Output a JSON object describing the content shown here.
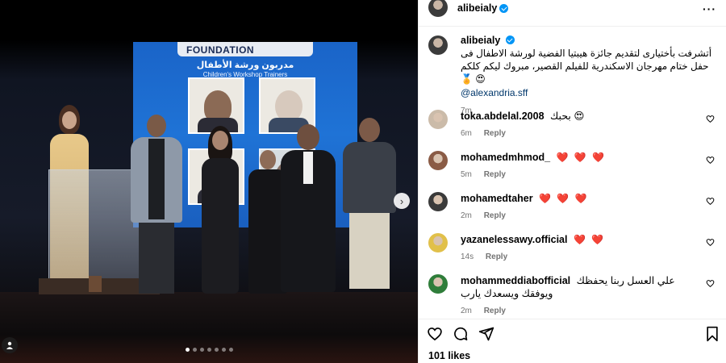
{
  "post": {
    "username": "alibeialy",
    "more_icon": "more-dots-icon",
    "caption": "أتشرفت بأختيارى لتقديم جائزة هيبتيا الفضية لورشة الاطفال فى حفل ختام مهرجان الاسكندرية للفيلم القصير، مبروك ليكم كلكم 😍 🏅",
    "caption_mention": "@alexandria.sff",
    "caption_time": "7m",
    "likes": "101 likes"
  },
  "media": {
    "screen_banner": "FOUNDATION",
    "screen_title_ar": "مدربون ورشة الأطفال",
    "screen_title_en": "Children's Workshop Trainers",
    "carousel_count": 7,
    "carousel_active": 0,
    "next_icon": "chevron-right-icon",
    "tag_icon": "user-tag-icon"
  },
  "comments": [
    {
      "user": "toka.abdelal.2008",
      "text": "بحبك 😍",
      "time": "6m",
      "reply": "Reply"
    },
    {
      "user": "mohamedmhmod_",
      "text": "❤️ ❤️ ❤️",
      "time": "5m",
      "reply": "Reply"
    },
    {
      "user": "mohamedtaher",
      "text": "❤️ ❤️ ❤️",
      "time": "2m",
      "reply": "Reply"
    },
    {
      "user": "yazanelessawy.official",
      "text": "❤️ ❤️",
      "time": "14s",
      "reply": "Reply"
    },
    {
      "user": "mohammeddiabofficial",
      "text": "علي العسل ربنا يحفظك ويوفقك ويسعدك يارب",
      "time": "2m",
      "reply": "Reply"
    }
  ],
  "actions": {
    "like_icon": "heart-icon",
    "comment_icon": "comment-icon",
    "share_icon": "share-icon",
    "save_icon": "bookmark-icon"
  },
  "colors": {
    "verified": "#0095f6",
    "link": "#00376b",
    "meta": "#737373",
    "heart": "#ff3040"
  }
}
